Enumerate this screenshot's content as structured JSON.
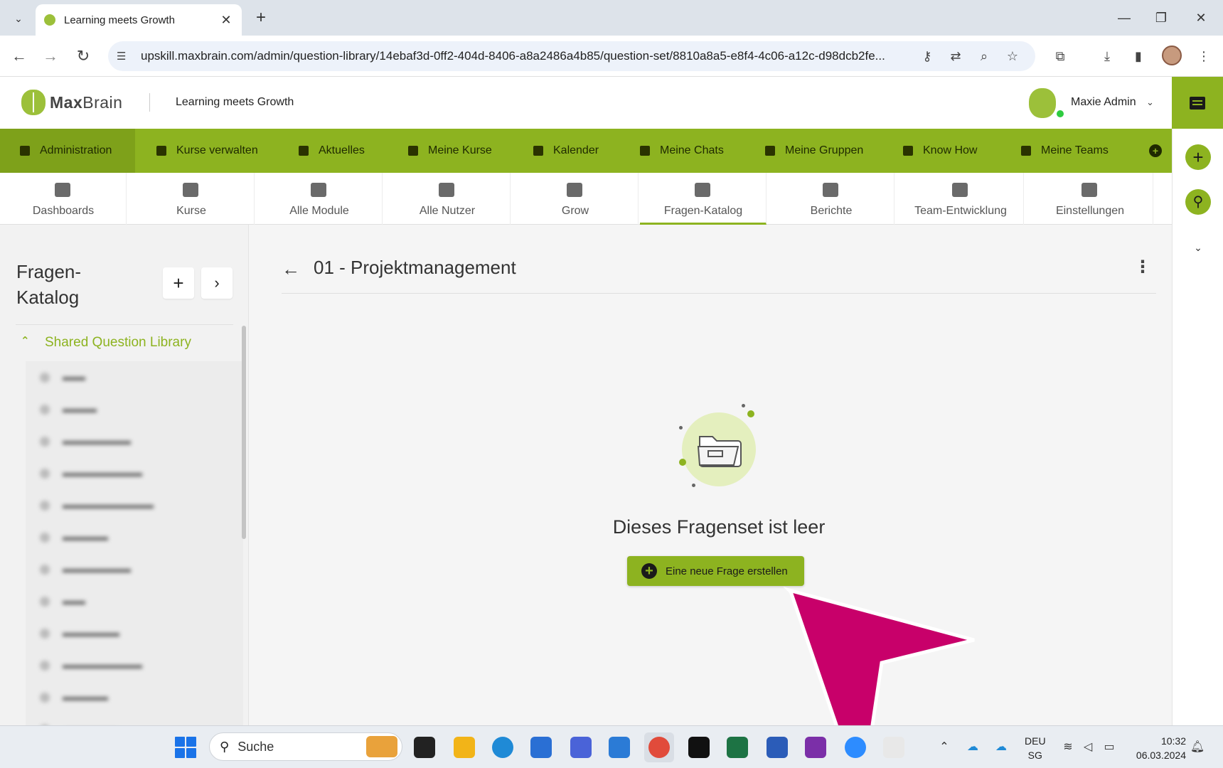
{
  "browser": {
    "tab_title": "Learning meets Growth",
    "url": "upskill.maxbrain.com/admin/question-library/14ebaf3d-0ff2-404d-8406-a8a2486a4b85/question-set/8810a8a5-e8f4-4c06-a12c-d98dcb2fe..."
  },
  "app": {
    "logo_text_bold": "Max",
    "logo_text_light": "Brain",
    "tagline": "Learning meets Growth",
    "user_name": "Maxie Admin"
  },
  "main_nav": {
    "items": [
      {
        "label": "Administration"
      },
      {
        "label": "Kurse verwalten"
      },
      {
        "label": "Aktuelles"
      },
      {
        "label": "Meine Kurse"
      },
      {
        "label": "Kalender"
      },
      {
        "label": "Meine Chats"
      },
      {
        "label": "Meine Gruppen"
      },
      {
        "label": "Know How"
      },
      {
        "label": "Meine Teams"
      }
    ]
  },
  "sub_nav": {
    "items": [
      {
        "label": "Dashboards"
      },
      {
        "label": "Kurse"
      },
      {
        "label": "Alle Module"
      },
      {
        "label": "Alle Nutzer"
      },
      {
        "label": "Grow"
      },
      {
        "label": "Fragen-Katalog"
      },
      {
        "label": "Berichte"
      },
      {
        "label": "Team-Entwicklung"
      },
      {
        "label": "Einstellungen"
      }
    ],
    "active": "Fragen-Katalog"
  },
  "sidebar": {
    "title": "Fragen-Katalog",
    "library_label": "Shared Question Library"
  },
  "content": {
    "set_title": "01 - Projektmanagement",
    "empty_heading": "Dieses Fragenset ist leer",
    "create_button_label": "Eine neue Frage erstellen"
  },
  "taskbar": {
    "search_label": "Suche",
    "lang_line1": "DEU",
    "lang_line2": "SG",
    "time": "10:32",
    "date": "06.03.2024"
  },
  "colors": {
    "brand_green": "#8db320",
    "pointer_magenta": "#c8006a"
  }
}
